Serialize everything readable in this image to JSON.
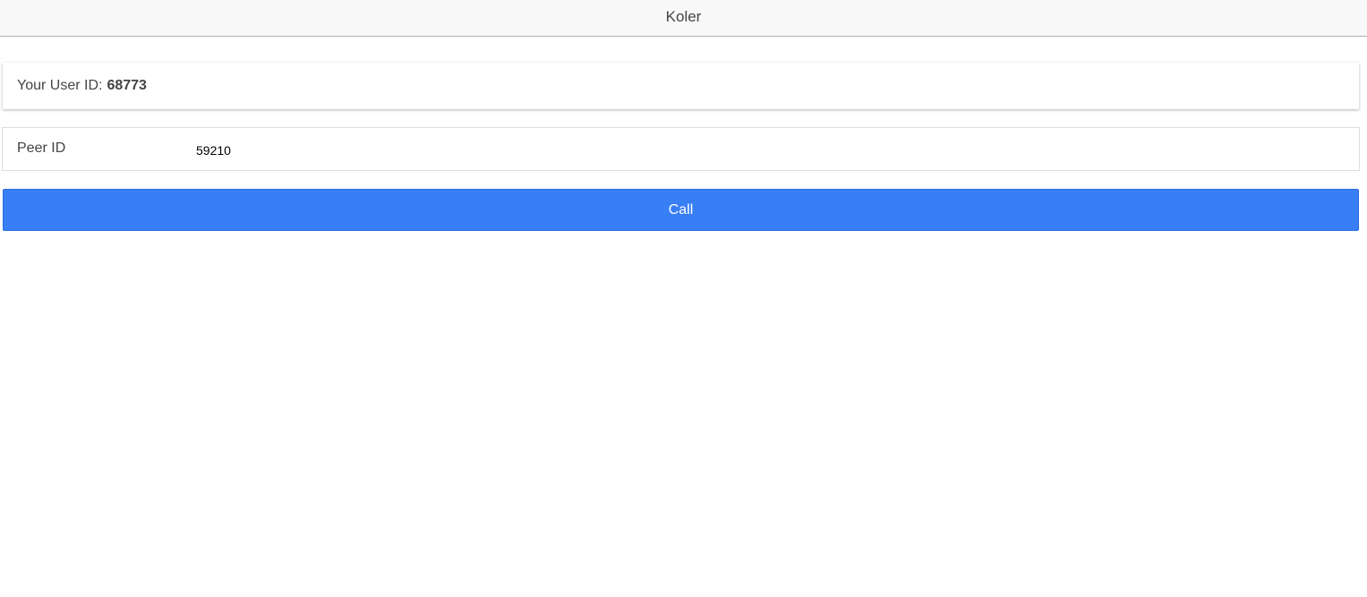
{
  "header": {
    "title": "Koler"
  },
  "user": {
    "label": "Your User ID:",
    "id": "68773"
  },
  "peer": {
    "label": "Peer ID",
    "value": "59210"
  },
  "call_button": {
    "label": "Call"
  },
  "colors": {
    "header_bg": "#f8f8f8",
    "primary": "#387ef5",
    "text": "#444444"
  }
}
